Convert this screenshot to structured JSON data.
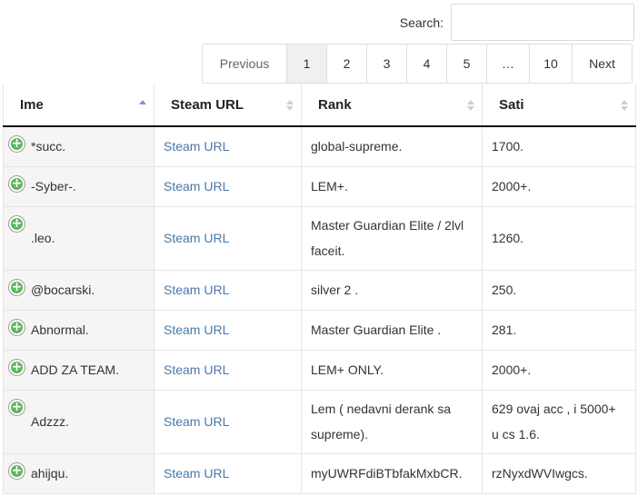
{
  "search": {
    "label": "Search:",
    "value": "",
    "placeholder": ""
  },
  "pagination": {
    "previous": "Previous",
    "pages": [
      "1",
      "2",
      "3",
      "4",
      "5",
      "…",
      "10"
    ],
    "next": "Next",
    "active": "1"
  },
  "table": {
    "headers": {
      "ime": "Ime",
      "steam_url": "Steam URL",
      "rank": "Rank",
      "sati": "Sati"
    },
    "rows": [
      {
        "ime": "*succ.",
        "steam_url": "Steam URL",
        "rank": "global-supreme.",
        "sati": "1700."
      },
      {
        "ime": "-Syber-.",
        "steam_url": "Steam URL",
        "rank": "LEM+.",
        "sati": "2000+."
      },
      {
        "ime": ".leo.",
        "steam_url": "Steam URL",
        "rank": "Master Guardian Elite / 2lvl faceit.",
        "sati": "1260."
      },
      {
        "ime": "@bocarski.",
        "steam_url": "Steam URL",
        "rank": "silver 2 .",
        "sati": "250."
      },
      {
        "ime": "Abnormal.",
        "steam_url": "Steam URL",
        "rank": "Master Guardian Elite .",
        "sati": "281."
      },
      {
        "ime": "ADD ZA TEAM.",
        "steam_url": "Steam URL",
        "rank": "LEM+ ONLY.",
        "sati": "2000+."
      },
      {
        "ime": "Adzzz.",
        "steam_url": "Steam URL",
        "rank": "Lem ( nedavni derank sa supreme).",
        "sati": "629 ovaj acc , i 5000+ u cs 1.6."
      },
      {
        "ime": "ahijqu.",
        "steam_url": "Steam URL",
        "rank": "myUWRFdiBTbfakMxbCR.",
        "sati": "rzNyxdWVIwgcs."
      }
    ]
  },
  "colors": {
    "link": "#4a78a8",
    "expand_icon": "#5cb85c",
    "sort_active": "#8f8fd0"
  }
}
